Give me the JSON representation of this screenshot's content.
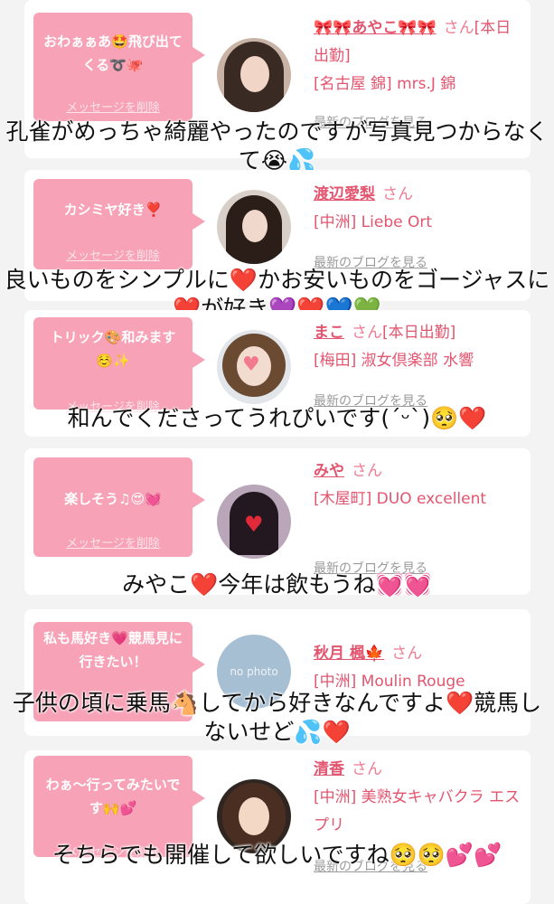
{
  "cards": [
    {
      "message": "おわぁぁあ🤩飛び出てくる➰🐙",
      "delete_label": "メッセージを削除",
      "name": "🎀🎀あやこ🎀🎀",
      "san": "さん",
      "status": "[本日出勤]",
      "store": "[名古屋 錦] mrs.J 錦",
      "blog_label": "最新のブログを見る",
      "reply": "孔雀がめっちゃ綺麗やったのですが写真見つからなくて😭💦"
    },
    {
      "message": "カシミヤ好き❣️",
      "delete_label": "メッセージを削除",
      "name": "渡辺愛梨",
      "san": "さん",
      "status": "",
      "store": "[中洲] Liebe Ort",
      "blog_label": "最新のブログを見る",
      "reply": "良いものをシンプルに❤️かお安いものをゴージャスに❤️が好き💜❤️💙💚"
    },
    {
      "message": "トリック🎨和みます☺️✨",
      "delete_label": "メッセージを削除",
      "name": "まこ",
      "san": "さん",
      "status": "[本日出勤]",
      "store": "[梅田] 淑女倶楽部 水響",
      "blog_label": "最新のブログを見る",
      "reply": "和んでくださってうれぴいです(ˊᵕˋ)🥺❤️"
    },
    {
      "message": "楽しそう♫😍💓",
      "delete_label": "メッセージを削除",
      "name": "みや",
      "san": "さん",
      "status": "",
      "store": "[木屋町] DUO excellent",
      "blog_label": "最新のブログを見る",
      "reply": "みやこ❤️今年は飲もうね💓💓"
    },
    {
      "message": "私も馬好き💗競馬見に行きたい！",
      "delete_label": "メッセージを削除",
      "name": "秋月 楓🍁",
      "san": "さん",
      "status": "",
      "store": "[中洲] Moulin Rouge",
      "blog_label": "最新のブログを見る",
      "avatar_text": "no photo",
      "reply": "子供の頃に乗馬🐴してから好きなんですよ❤️競馬しないせど💦❤️"
    },
    {
      "message": "わぁ〜行ってみたいです🙌💕",
      "delete_label": "メッセージを削除",
      "name": "清香",
      "san": "さん",
      "status": "",
      "store": "[中洲] 美熟女キャバクラ エスプリ",
      "blog_label": "最新のブログを見る",
      "reply": "そちらでも開催して欲しいですね🥺🥺💕💕"
    }
  ]
}
